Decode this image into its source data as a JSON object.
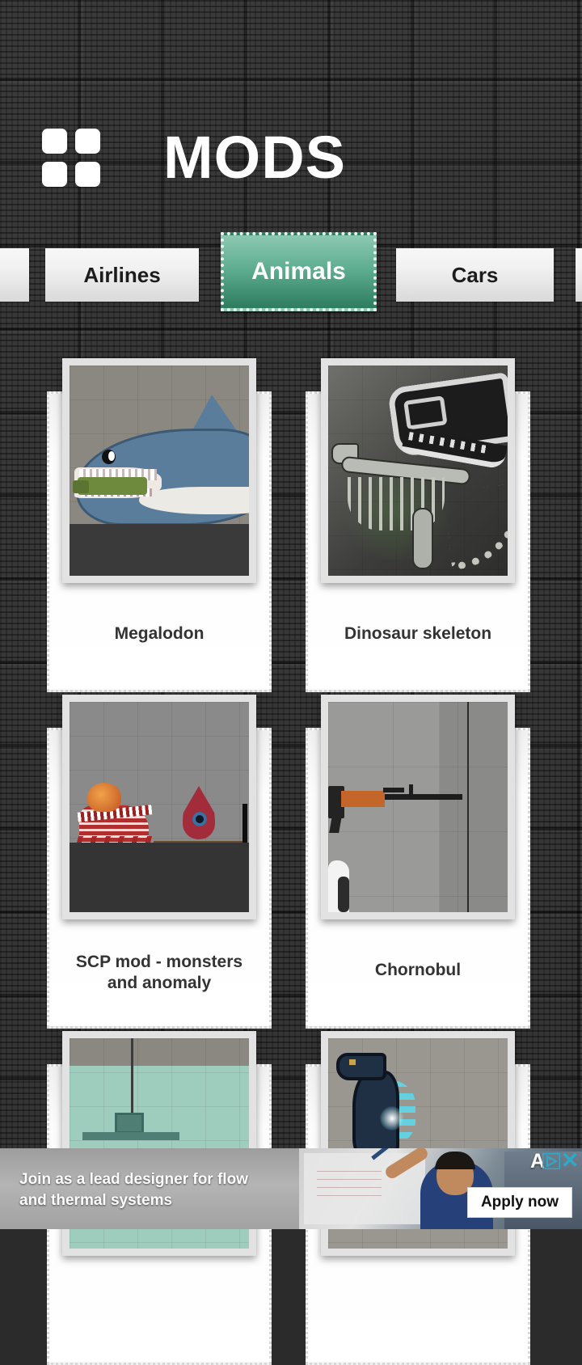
{
  "header": {
    "title": "MODS",
    "logo_icon": "grid-2x2-icon"
  },
  "tabs": {
    "items": [
      {
        "label": "",
        "active": false,
        "partial": true
      },
      {
        "label": "Airlines",
        "active": false,
        "partial": false
      },
      {
        "label": "Animals",
        "active": true,
        "partial": false
      },
      {
        "label": "Cars",
        "active": false,
        "partial": false
      },
      {
        "label": "",
        "active": false,
        "partial": true
      }
    ],
    "selected": "Animals",
    "selected_bg_top": "#8cc9b1",
    "selected_bg_bottom": "#2f7d5f",
    "inactive_text_color": "#1c1c1c"
  },
  "mods": [
    {
      "title": "Megalodon"
    },
    {
      "title": "Dinosaur skeleton"
    },
    {
      "title": "SCP mod - monsters and anomaly"
    },
    {
      "title": "Chornobul"
    },
    {
      "title": ""
    },
    {
      "title": ""
    }
  ],
  "ad": {
    "headline": "Join as a lead designer for flow and thermal systems",
    "cta_label": "Apply now",
    "mark_label": "A",
    "adchoices_icon": "adchoices-triangle-icon",
    "close_icon": "close-x-icon",
    "close_color": "#2ea9c9"
  },
  "colors": {
    "background": "#2e2e2e",
    "card_background": "#ffffff",
    "card_title": "#333333",
    "accent_green": "#2f7d5f"
  }
}
